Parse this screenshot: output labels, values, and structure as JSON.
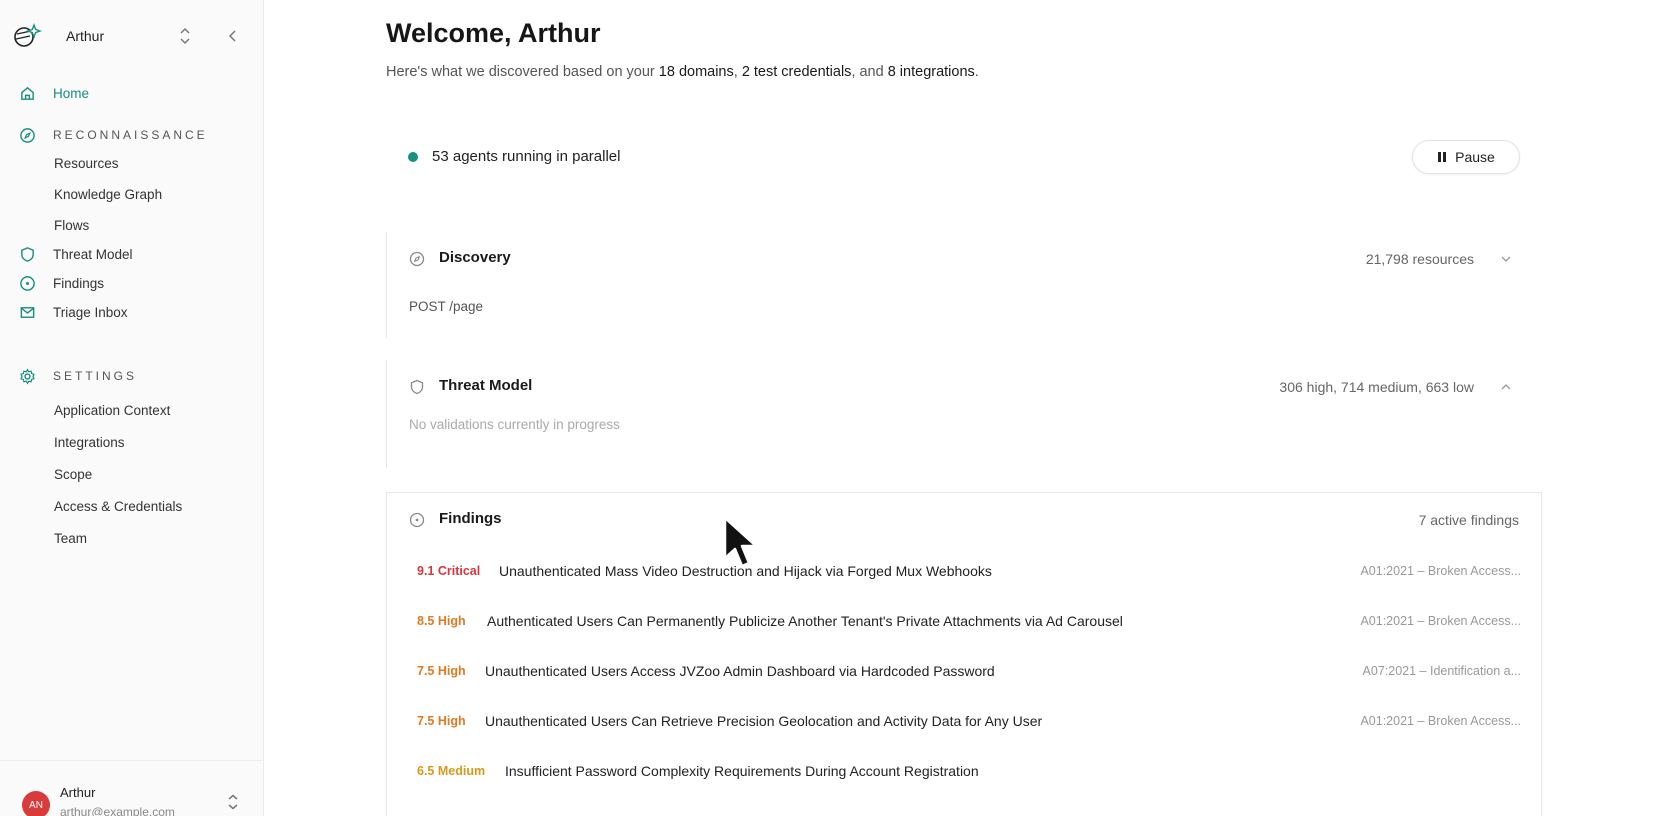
{
  "workspace": {
    "name": "Arthur"
  },
  "nav": {
    "home": "Home",
    "reconnaissance": "RECONNAISSANCE",
    "resources": "Resources",
    "knowledge_graph": "Knowledge Graph",
    "flows": "Flows",
    "threat_model": "Threat Model",
    "findings": "Findings",
    "triage_inbox": "Triage Inbox",
    "settings": "SETTINGS",
    "application_context": "Application Context",
    "integrations": "Integrations",
    "scope": "Scope",
    "access_credentials": "Access & Credentials",
    "team": "Team"
  },
  "user": {
    "initials": "AN",
    "name": "Arthur",
    "email": "arthur@example.com"
  },
  "header": {
    "title": "Welcome, Arthur",
    "sub_prefix": "Here's what we discovered based on your ",
    "domains": "18 domains",
    "sep1": ", ",
    "credentials": "2 test credentials",
    "sep2": ", and ",
    "integrations": "8 integrations",
    "suffix": "."
  },
  "agents": {
    "status": "53 agents running in parallel",
    "pause_label": "Pause"
  },
  "discovery": {
    "title": "Discovery",
    "meta": "21,798 resources",
    "current": "POST /page"
  },
  "threat_model": {
    "title": "Threat Model",
    "meta": "306 high, 714 medium, 663 low",
    "status": "No validations currently in progress"
  },
  "findings": {
    "title": "Findings",
    "meta": "7 active findings",
    "items": [
      {
        "severity": "9.1 Critical",
        "level": "critical",
        "title": "Unauthenticated Mass Video Destruction and Hijack via Forged Mux Webhooks",
        "category": "A01:2021 – Broken Access..."
      },
      {
        "severity": "8.5 High",
        "level": "high",
        "title": "Authenticated Users Can Permanently Publicize Another Tenant's Private Attachments via Ad Carousel",
        "category": "A01:2021 – Broken Access..."
      },
      {
        "severity": "7.5 High",
        "level": "high",
        "title": "Unauthenticated Users Access JVZoo Admin Dashboard via Hardcoded Password",
        "category": "A07:2021 – Identification a..."
      },
      {
        "severity": "7.5 High",
        "level": "high",
        "title": "Unauthenticated Users Can Retrieve Precision Geolocation and Activity Data for Any User",
        "category": "A01:2021 – Broken Access..."
      },
      {
        "severity": "6.5 Medium",
        "level": "medium",
        "title": "Insufficient Password Complexity Requirements During Account Registration",
        "category": ""
      }
    ]
  },
  "colors": {
    "accent": "#1b8e7e",
    "critical": "#d4373e",
    "high": "#e07a22",
    "medium": "#d99a1a"
  }
}
